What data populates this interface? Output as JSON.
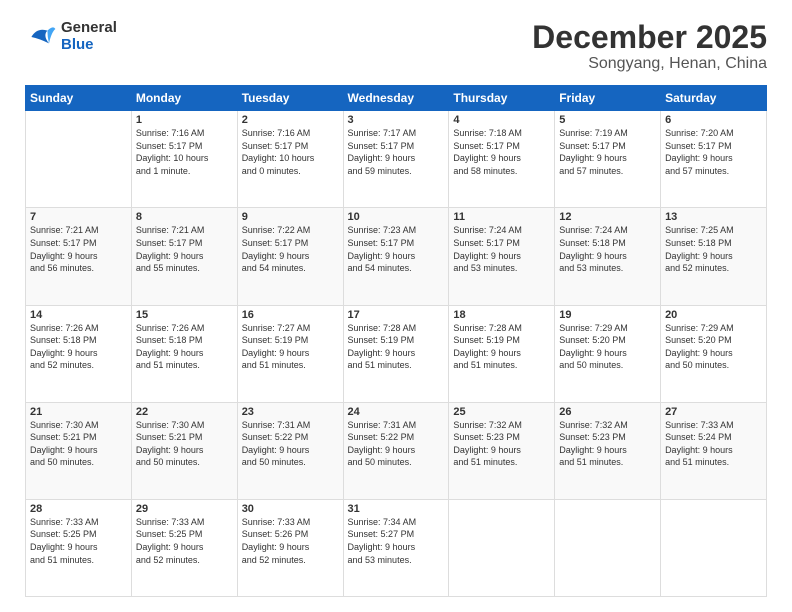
{
  "logo": {
    "line1": "General",
    "line2": "Blue"
  },
  "title": "December 2025",
  "subtitle": "Songyang, Henan, China",
  "days_of_week": [
    "Sunday",
    "Monday",
    "Tuesday",
    "Wednesday",
    "Thursday",
    "Friday",
    "Saturday"
  ],
  "weeks": [
    [
      {
        "day": "",
        "info": ""
      },
      {
        "day": "1",
        "info": "Sunrise: 7:16 AM\nSunset: 5:17 PM\nDaylight: 10 hours\nand 1 minute."
      },
      {
        "day": "2",
        "info": "Sunrise: 7:16 AM\nSunset: 5:17 PM\nDaylight: 10 hours\nand 0 minutes."
      },
      {
        "day": "3",
        "info": "Sunrise: 7:17 AM\nSunset: 5:17 PM\nDaylight: 9 hours\nand 59 minutes."
      },
      {
        "day": "4",
        "info": "Sunrise: 7:18 AM\nSunset: 5:17 PM\nDaylight: 9 hours\nand 58 minutes."
      },
      {
        "day": "5",
        "info": "Sunrise: 7:19 AM\nSunset: 5:17 PM\nDaylight: 9 hours\nand 57 minutes."
      },
      {
        "day": "6",
        "info": "Sunrise: 7:20 AM\nSunset: 5:17 PM\nDaylight: 9 hours\nand 57 minutes."
      }
    ],
    [
      {
        "day": "7",
        "info": "Sunrise: 7:21 AM\nSunset: 5:17 PM\nDaylight: 9 hours\nand 56 minutes."
      },
      {
        "day": "8",
        "info": "Sunrise: 7:21 AM\nSunset: 5:17 PM\nDaylight: 9 hours\nand 55 minutes."
      },
      {
        "day": "9",
        "info": "Sunrise: 7:22 AM\nSunset: 5:17 PM\nDaylight: 9 hours\nand 54 minutes."
      },
      {
        "day": "10",
        "info": "Sunrise: 7:23 AM\nSunset: 5:17 PM\nDaylight: 9 hours\nand 54 minutes."
      },
      {
        "day": "11",
        "info": "Sunrise: 7:24 AM\nSunset: 5:17 PM\nDaylight: 9 hours\nand 53 minutes."
      },
      {
        "day": "12",
        "info": "Sunrise: 7:24 AM\nSunset: 5:18 PM\nDaylight: 9 hours\nand 53 minutes."
      },
      {
        "day": "13",
        "info": "Sunrise: 7:25 AM\nSunset: 5:18 PM\nDaylight: 9 hours\nand 52 minutes."
      }
    ],
    [
      {
        "day": "14",
        "info": "Sunrise: 7:26 AM\nSunset: 5:18 PM\nDaylight: 9 hours\nand 52 minutes."
      },
      {
        "day": "15",
        "info": "Sunrise: 7:26 AM\nSunset: 5:18 PM\nDaylight: 9 hours\nand 51 minutes."
      },
      {
        "day": "16",
        "info": "Sunrise: 7:27 AM\nSunset: 5:19 PM\nDaylight: 9 hours\nand 51 minutes."
      },
      {
        "day": "17",
        "info": "Sunrise: 7:28 AM\nSunset: 5:19 PM\nDaylight: 9 hours\nand 51 minutes."
      },
      {
        "day": "18",
        "info": "Sunrise: 7:28 AM\nSunset: 5:19 PM\nDaylight: 9 hours\nand 51 minutes."
      },
      {
        "day": "19",
        "info": "Sunrise: 7:29 AM\nSunset: 5:20 PM\nDaylight: 9 hours\nand 50 minutes."
      },
      {
        "day": "20",
        "info": "Sunrise: 7:29 AM\nSunset: 5:20 PM\nDaylight: 9 hours\nand 50 minutes."
      }
    ],
    [
      {
        "day": "21",
        "info": "Sunrise: 7:30 AM\nSunset: 5:21 PM\nDaylight: 9 hours\nand 50 minutes."
      },
      {
        "day": "22",
        "info": "Sunrise: 7:30 AM\nSunset: 5:21 PM\nDaylight: 9 hours\nand 50 minutes."
      },
      {
        "day": "23",
        "info": "Sunrise: 7:31 AM\nSunset: 5:22 PM\nDaylight: 9 hours\nand 50 minutes."
      },
      {
        "day": "24",
        "info": "Sunrise: 7:31 AM\nSunset: 5:22 PM\nDaylight: 9 hours\nand 50 minutes."
      },
      {
        "day": "25",
        "info": "Sunrise: 7:32 AM\nSunset: 5:23 PM\nDaylight: 9 hours\nand 51 minutes."
      },
      {
        "day": "26",
        "info": "Sunrise: 7:32 AM\nSunset: 5:23 PM\nDaylight: 9 hours\nand 51 minutes."
      },
      {
        "day": "27",
        "info": "Sunrise: 7:33 AM\nSunset: 5:24 PM\nDaylight: 9 hours\nand 51 minutes."
      }
    ],
    [
      {
        "day": "28",
        "info": "Sunrise: 7:33 AM\nSunset: 5:25 PM\nDaylight: 9 hours\nand 51 minutes."
      },
      {
        "day": "29",
        "info": "Sunrise: 7:33 AM\nSunset: 5:25 PM\nDaylight: 9 hours\nand 52 minutes."
      },
      {
        "day": "30",
        "info": "Sunrise: 7:33 AM\nSunset: 5:26 PM\nDaylight: 9 hours\nand 52 minutes."
      },
      {
        "day": "31",
        "info": "Sunrise: 7:34 AM\nSunset: 5:27 PM\nDaylight: 9 hours\nand 53 minutes."
      },
      {
        "day": "",
        "info": ""
      },
      {
        "day": "",
        "info": ""
      },
      {
        "day": "",
        "info": ""
      }
    ]
  ]
}
